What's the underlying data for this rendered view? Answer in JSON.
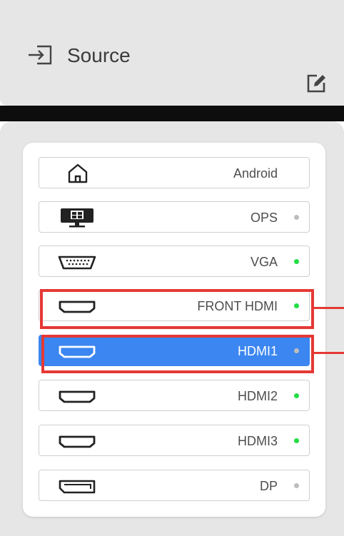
{
  "header": {
    "title": "Source",
    "icon": "input-source-icon",
    "edit_icon": "edit-icon"
  },
  "sources": [
    {
      "label": "Android",
      "icon": "home-icon",
      "status": "none",
      "dot_color": ""
    },
    {
      "label": "OPS",
      "icon": "ops-computer-icon",
      "status": "inactive",
      "dot_color": "#bdbdbd"
    },
    {
      "label": "VGA",
      "icon": "vga-port-icon",
      "status": "active",
      "dot_color": "#22dd44"
    },
    {
      "label": "FRONT HDMI",
      "icon": "hdmi-port-icon",
      "status": "active",
      "dot_color": "#22dd44"
    },
    {
      "label": "HDMI1",
      "icon": "hdmi-port-icon",
      "status": "inactive",
      "dot_color": "#bdbdbd",
      "selected": true
    },
    {
      "label": "HDMI2",
      "icon": "hdmi-port-icon",
      "status": "active",
      "dot_color": "#22dd44"
    },
    {
      "label": "HDMI3",
      "icon": "hdmi-port-icon",
      "status": "active",
      "dot_color": "#22dd44"
    },
    {
      "label": "DP",
      "icon": "displayport-icon",
      "status": "inactive",
      "dot_color": "#bdbdbd"
    }
  ],
  "colors": {
    "selected": "#3b86f0",
    "annotation": "#e53935",
    "active_dot": "#22dd44",
    "inactive_dot": "#bdbdbd"
  },
  "annotations": [
    "FRONT HDMI",
    "HDMI1"
  ]
}
